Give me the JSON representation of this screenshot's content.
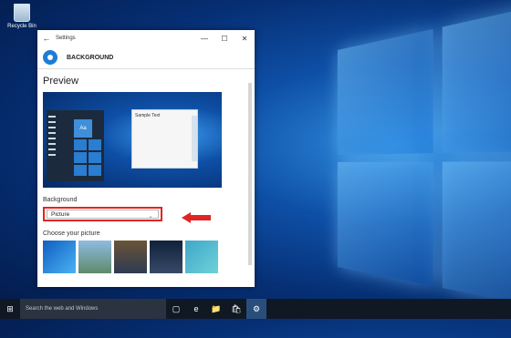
{
  "desktop": {
    "recycle_bin_label": "Recycle Bin"
  },
  "window": {
    "title": "Settings",
    "back_icon": "back-arrow-icon",
    "header_title": "BACKGROUND",
    "preview": {
      "heading": "Preview",
      "sample_text": "Sample Text",
      "tile_text": "Aa"
    },
    "background_label": "Background",
    "background_value": "Picture",
    "choose_label": "Choose your picture"
  },
  "taskbar": {
    "search_placeholder": "Search the web and Windows",
    "start_icon": "⊞",
    "task_view_icon": "▢",
    "edge_icon": "e",
    "explorer_icon": "📁",
    "store_icon": "🛍",
    "settings_icon": "⚙"
  },
  "colors": {
    "highlight": "#e02424",
    "accent": "#1e7bd6"
  }
}
